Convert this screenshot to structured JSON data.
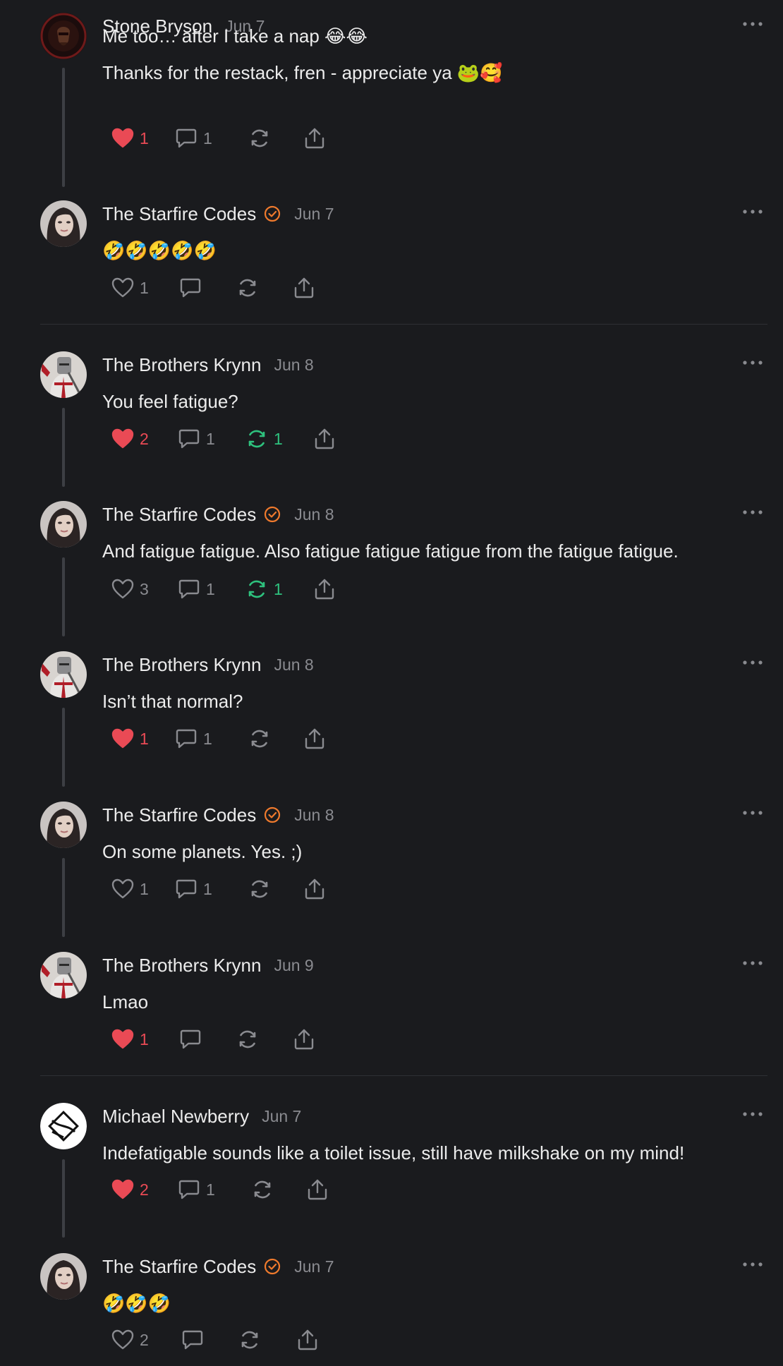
{
  "comments": [
    {
      "author": "Stone Bryson",
      "date": "Jun 7",
      "verified": false,
      "avatar": "stone-avatar",
      "body": [
        "Me too… after I take a nap 😂😂",
        "Thanks for the restack, fren - appreciate ya 🐸🥰"
      ],
      "likes": "1",
      "liked": true,
      "replies": "1",
      "restacks": "",
      "restacked": false
    },
    {
      "author": "The Starfire Codes",
      "date": "Jun 7",
      "verified": true,
      "avatar": "starfire-avatar",
      "body": [
        "🤣🤣🤣🤣🤣"
      ],
      "likes": "1",
      "liked": false,
      "replies": "",
      "restacks": "",
      "restacked": false
    },
    {
      "author": "The Brothers Krynn",
      "date": "Jun 8",
      "verified": false,
      "avatar": "krynn-avatar",
      "body": [
        "You feel fatigue?"
      ],
      "likes": "2",
      "liked": true,
      "replies": "1",
      "restacks": "1",
      "restacked": true
    },
    {
      "author": "The Starfire Codes",
      "date": "Jun 8",
      "verified": true,
      "avatar": "starfire-avatar",
      "body": [
        "And fatigue fatigue. Also fatigue fatigue fatigue from the fatigue fatigue."
      ],
      "likes": "3",
      "liked": false,
      "replies": "1",
      "restacks": "1",
      "restacked": true
    },
    {
      "author": "The Brothers Krynn",
      "date": "Jun 8",
      "verified": false,
      "avatar": "krynn-avatar",
      "body": [
        "Isn’t that normal?"
      ],
      "likes": "1",
      "liked": true,
      "replies": "1",
      "restacks": "",
      "restacked": false
    },
    {
      "author": "The Starfire Codes",
      "date": "Jun 8",
      "verified": true,
      "avatar": "starfire-avatar",
      "body": [
        "On some planets. Yes. ;)"
      ],
      "likes": "1",
      "liked": false,
      "replies": "1",
      "restacks": "",
      "restacked": false
    },
    {
      "author": "The Brothers Krynn",
      "date": "Jun 9",
      "verified": false,
      "avatar": "krynn-avatar",
      "body": [
        "Lmao"
      ],
      "likes": "1",
      "liked": true,
      "replies": "",
      "restacks": "",
      "restacked": false
    },
    {
      "author": "Michael Newberry",
      "date": "Jun 7",
      "verified": false,
      "avatar": "newberry-avatar",
      "body": [
        "Indefatigable sounds like a toilet issue, still have milkshake on my mind!"
      ],
      "likes": "2",
      "liked": true,
      "replies": "1",
      "restacks": "",
      "restacked": false
    },
    {
      "author": "The Starfire Codes",
      "date": "Jun 7",
      "verified": true,
      "avatar": "starfire-avatar",
      "body": [
        "🤣🤣🤣"
      ],
      "likes": "2",
      "liked": false,
      "replies": "",
      "restacks": "",
      "restacked": false
    }
  ],
  "colors": {
    "background": "#1a1b1e",
    "like_active": "#ea4a55",
    "restack_active": "#2ec27e",
    "verified_badge": "#ef7a2d",
    "muted": "#8a8b90"
  }
}
